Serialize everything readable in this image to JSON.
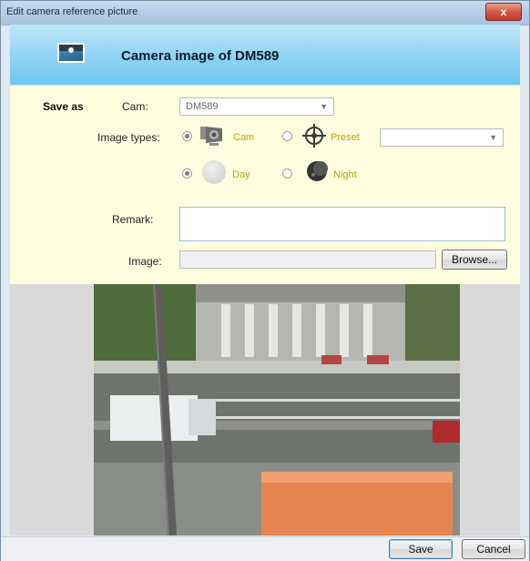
{
  "window": {
    "title": "Edit camera reference picture",
    "close_label": "x"
  },
  "header": {
    "title": "Camera image of DM589",
    "icon": "picture-icon"
  },
  "form": {
    "save_as_label": "Save as",
    "cam_label": "Cam:",
    "cam_value": "DM589",
    "image_types_label": "Image types:",
    "options": {
      "cam": "Cam",
      "preset": "Preset",
      "day": "Day",
      "night": "Night"
    },
    "preset_value": "",
    "remark_label": "Remark:",
    "remark_value": "",
    "image_label": "Image:",
    "image_value": "",
    "browse_label": "Browse..."
  },
  "footer": {
    "save_label": "Save",
    "cancel_label": "Cancel"
  },
  "colors": {
    "header_top": "#bfe6f8",
    "header_bottom": "#6cc8f0",
    "form_bg": "#fffde0",
    "option_text": "#b8a500",
    "close_button": "#c0392b"
  }
}
